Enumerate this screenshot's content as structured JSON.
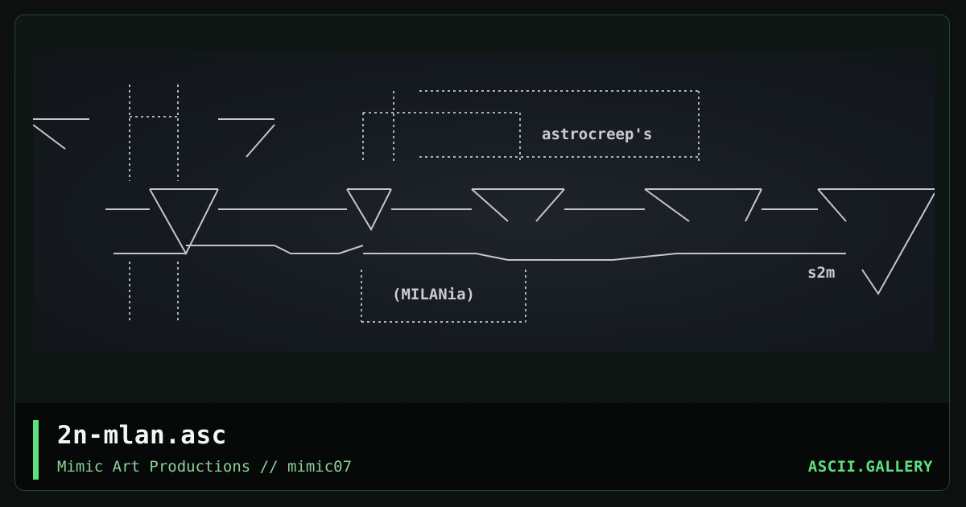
{
  "card": {
    "title": "2n-mlan.asc",
    "subtitle": "Mimic Art Productions // mimic07",
    "brand": "ASCII.GALLERY"
  },
  "art": {
    "text_astrocreep": "astrocreep's",
    "text_milania": "(MILANia)",
    "text_s2m": "s2m"
  }
}
